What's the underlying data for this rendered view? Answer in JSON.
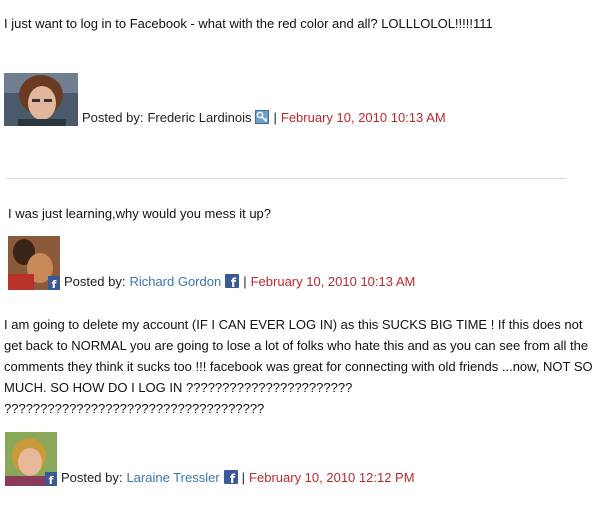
{
  "comments": [
    {
      "text": "I just want to log in to Facebook - what with the red color and all? LOLLLOLOL!!!!!111",
      "posted_label": "Posted by:",
      "author": "Frederic Lardinois",
      "badge_icon": "admin-key-icon",
      "separator": "|",
      "date": "February 10, 2010 10:13 AM"
    },
    {
      "text": "I was just learning,why would you mess it up?",
      "posted_label": "Posted by:",
      "author": "Richard Gordon",
      "badge_icon": "facebook-icon",
      "separator": "|",
      "date": "February 10, 2010 10:13 AM"
    },
    {
      "text": "I am going to delete my account (IF I CAN EVER LOG IN) as this SUCKS BIG TIME ! If this does not get back to NORMAL you are going to lose a lot of folks who hate this and as you can see from all the comments they think it sucks too !!! facebook was great for connecting with old friends ...now, NOT SO MUCH. SO HOW DO I LOG IN ??????????????????????? ????????????????????????????????????",
      "posted_label": "Posted by:",
      "author": "Laraine Tressler",
      "badge_icon": "facebook-icon",
      "separator": "|",
      "date": "February 10, 2010 12:12 PM"
    }
  ],
  "colors": {
    "author_link": "#3b76b0",
    "date": "#c0282d",
    "facebook_blue": "#3b5998"
  }
}
